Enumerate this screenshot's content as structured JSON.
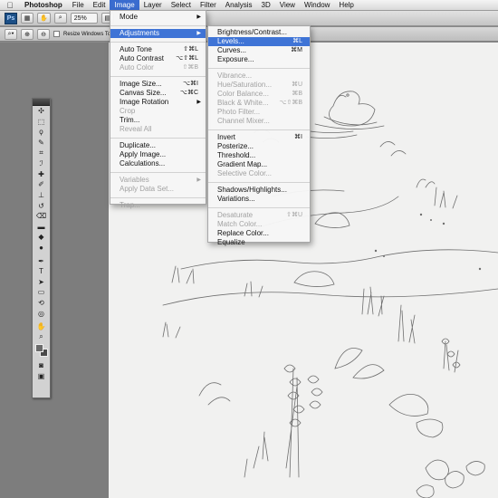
{
  "menubar": {
    "apple": "",
    "items": [
      "Photoshop",
      "File",
      "Edit",
      "Image",
      "Layer",
      "Select",
      "Filter",
      "Analysis",
      "3D",
      "View",
      "Window",
      "Help"
    ],
    "active": "Image"
  },
  "appbar": {
    "logo": "Ps",
    "zoom": "25%"
  },
  "options": {
    "resize_label": "Resize Windows To Fit"
  },
  "image_menu": {
    "items": [
      {
        "label": "Mode",
        "shortcut": "",
        "submenu": true,
        "disabled": false
      },
      {
        "sep": true
      },
      {
        "label": "Adjustments",
        "shortcut": "",
        "submenu": true,
        "disabled": false,
        "highlight": true
      },
      {
        "sep": true
      },
      {
        "label": "Auto Tone",
        "shortcut": "⇧⌘L",
        "disabled": false
      },
      {
        "label": "Auto Contrast",
        "shortcut": "⌥⇧⌘L",
        "disabled": false
      },
      {
        "label": "Auto Color",
        "shortcut": "⇧⌘B",
        "disabled": true
      },
      {
        "sep": true
      },
      {
        "label": "Image Size...",
        "shortcut": "⌥⌘I",
        "disabled": false
      },
      {
        "label": "Canvas Size...",
        "shortcut": "⌥⌘C",
        "disabled": false
      },
      {
        "label": "Image Rotation",
        "shortcut": "",
        "submenu": true,
        "disabled": false
      },
      {
        "label": "Crop",
        "shortcut": "",
        "disabled": true
      },
      {
        "label": "Trim...",
        "shortcut": "",
        "disabled": false
      },
      {
        "label": "Reveal All",
        "shortcut": "",
        "disabled": true
      },
      {
        "sep": true
      },
      {
        "label": "Duplicate...",
        "shortcut": "",
        "disabled": false
      },
      {
        "label": "Apply Image...",
        "shortcut": "",
        "disabled": false
      },
      {
        "label": "Calculations...",
        "shortcut": "",
        "disabled": false
      },
      {
        "sep": true
      },
      {
        "label": "Variables",
        "shortcut": "",
        "submenu": true,
        "disabled": true
      },
      {
        "label": "Apply Data Set...",
        "shortcut": "",
        "disabled": true
      },
      {
        "sep": true
      },
      {
        "label": "Trap...",
        "shortcut": "",
        "disabled": true
      }
    ]
  },
  "adjust_menu": {
    "items": [
      {
        "label": "Brightness/Contrast...",
        "shortcut": "",
        "disabled": false
      },
      {
        "label": "Levels...",
        "shortcut": "⌘L",
        "disabled": false,
        "highlight": true
      },
      {
        "label": "Curves...",
        "shortcut": "⌘M",
        "disabled": false
      },
      {
        "label": "Exposure...",
        "shortcut": "",
        "disabled": false
      },
      {
        "sep": true
      },
      {
        "label": "Vibrance...",
        "shortcut": "",
        "disabled": true
      },
      {
        "label": "Hue/Saturation...",
        "shortcut": "⌘U",
        "disabled": true
      },
      {
        "label": "Color Balance...",
        "shortcut": "⌘B",
        "disabled": true
      },
      {
        "label": "Black & White...",
        "shortcut": "⌥⇧⌘B",
        "disabled": true
      },
      {
        "label": "Photo Filter...",
        "shortcut": "",
        "disabled": true
      },
      {
        "label": "Channel Mixer...",
        "shortcut": "",
        "disabled": true
      },
      {
        "sep": true
      },
      {
        "label": "Invert",
        "shortcut": "⌘I",
        "disabled": false
      },
      {
        "label": "Posterize...",
        "shortcut": "",
        "disabled": false
      },
      {
        "label": "Threshold...",
        "shortcut": "",
        "disabled": false
      },
      {
        "label": "Gradient Map...",
        "shortcut": "",
        "disabled": false
      },
      {
        "label": "Selective Color...",
        "shortcut": "",
        "disabled": true
      },
      {
        "sep": true
      },
      {
        "label": "Shadows/Highlights...",
        "shortcut": "",
        "disabled": false
      },
      {
        "label": "Variations...",
        "shortcut": "",
        "disabled": false
      },
      {
        "sep": true
      },
      {
        "label": "Desaturate",
        "shortcut": "⇧⌘U",
        "disabled": true
      },
      {
        "label": "Match Color...",
        "shortcut": "",
        "disabled": true
      },
      {
        "label": "Replace Color...",
        "shortcut": "",
        "disabled": false
      },
      {
        "label": "Equalize",
        "shortcut": "",
        "disabled": false
      }
    ]
  },
  "tools": [
    "move",
    "marquee",
    "lasso",
    "quick-select",
    "crop",
    "eyedropper",
    "healing",
    "brush",
    "clone-stamp",
    "history-brush",
    "eraser",
    "gradient",
    "blur",
    "dodge",
    "pen",
    "type",
    "path-select",
    "shape",
    "3d-rotate",
    "3d-orbit",
    "hand",
    "zoom"
  ],
  "colors": {
    "menu_highlight": "#3f74d6",
    "menubar_active": "#3a6ccf",
    "canvas": "#f1f1f0",
    "workspace": "#7d7d7d",
    "pencil": "#6e6e6e"
  }
}
